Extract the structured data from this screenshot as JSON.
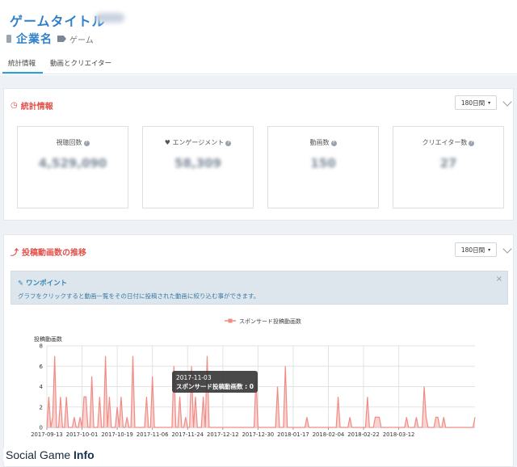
{
  "header": {
    "game_title": "ゲームタイトル",
    "company_name": "企業名",
    "category": "ゲーム"
  },
  "tabs": [
    {
      "label": "統計情報",
      "active": true
    },
    {
      "label": "動画とクリエイター",
      "active": false
    }
  ],
  "stats_panel": {
    "title": "統計情報",
    "period": "180日間",
    "cards": [
      {
        "label": "視聴回数",
        "value": "4,529,090"
      },
      {
        "label": "エンゲージメント",
        "value": "58,309"
      },
      {
        "label": "動画数",
        "value": "150"
      },
      {
        "label": "クリエイター数",
        "value": "27"
      }
    ]
  },
  "trend_panel": {
    "title": "投稿動画数の推移",
    "period": "180日間",
    "hint_title": "ワンポイント",
    "hint_text": "グラフをクリックすると動画一覧をその日付に投稿された動画に絞り込む事ができます。",
    "close_symbol": "×"
  },
  "tooltip": {
    "date": "2017-11-03",
    "text": "スポンサード投稿動画数 : 0"
  },
  "watermark": {
    "part1": "Social Game ",
    "part2": "Info"
  },
  "colors": {
    "accent_red": "#e0524c",
    "brand_blue": "#2f80c9",
    "series": "#f08b85",
    "series_fill": "#f7c2be"
  },
  "chart_data": {
    "type": "area",
    "ylabel": "投稿動画数",
    "legend": "スポンサード投稿動画数",
    "legend_position": "top-center",
    "ylim": [
      0,
      8
    ],
    "yticks": [
      0,
      2,
      4,
      6,
      8
    ],
    "grid": true,
    "xticks": [
      "2017-09-13",
      "2017-10-01",
      "2017-10-19",
      "2017-11-06",
      "2017-11-24",
      "2017-12-12",
      "2017-12-30",
      "2018-01-17",
      "2018-02-04",
      "2018-02-22",
      "2018-03-12"
    ],
    "x_start": "2017-09-13",
    "values": [
      0,
      3,
      0,
      1,
      7,
      0,
      0,
      3,
      0,
      0,
      3,
      0,
      0,
      0,
      1,
      0,
      0,
      1,
      0,
      3,
      3,
      0,
      0,
      5,
      0,
      0,
      0,
      3,
      0,
      0,
      7,
      0,
      3,
      0,
      0,
      0,
      2,
      0,
      3,
      0,
      0,
      1,
      0,
      0,
      7,
      0,
      0,
      0,
      0,
      0,
      0,
      3,
      0,
      0,
      5,
      0,
      0,
      0,
      0,
      0,
      0,
      0,
      0,
      0,
      0,
      6,
      0,
      0,
      3,
      0,
      0,
      1,
      0,
      0,
      6,
      0,
      3,
      0,
      0,
      0,
      3,
      0,
      7,
      0,
      0,
      0,
      0,
      0,
      0,
      0,
      0,
      0,
      0,
      0,
      0,
      0,
      0,
      0,
      0,
      0,
      0,
      0,
      0,
      0,
      0,
      0,
      0,
      5,
      0,
      0,
      0,
      0,
      0,
      0,
      0,
      0,
      0,
      0,
      4,
      0,
      0,
      0,
      6,
      0,
      0,
      0,
      0,
      0,
      0,
      0,
      0,
      0,
      0,
      1,
      0,
      0,
      0,
      0,
      0,
      0,
      0,
      0,
      0,
      0,
      0,
      0,
      0,
      0,
      0,
      3,
      0,
      0,
      0,
      0,
      0,
      1,
      0,
      0,
      0,
      0,
      0,
      0,
      0,
      0,
      3,
      0,
      0,
      0,
      1,
      1,
      1,
      0,
      0,
      0,
      0,
      0,
      0,
      0,
      0,
      0,
      0,
      0,
      0,
      0,
      1,
      0,
      0,
      0,
      0,
      1,
      0,
      0,
      0,
      4,
      1,
      0,
      0,
      0,
      0,
      1,
      1,
      0,
      0,
      1,
      0,
      0,
      0,
      0,
      0,
      0,
      0,
      0,
      0,
      0,
      0,
      0,
      0,
      0,
      0,
      1
    ]
  }
}
